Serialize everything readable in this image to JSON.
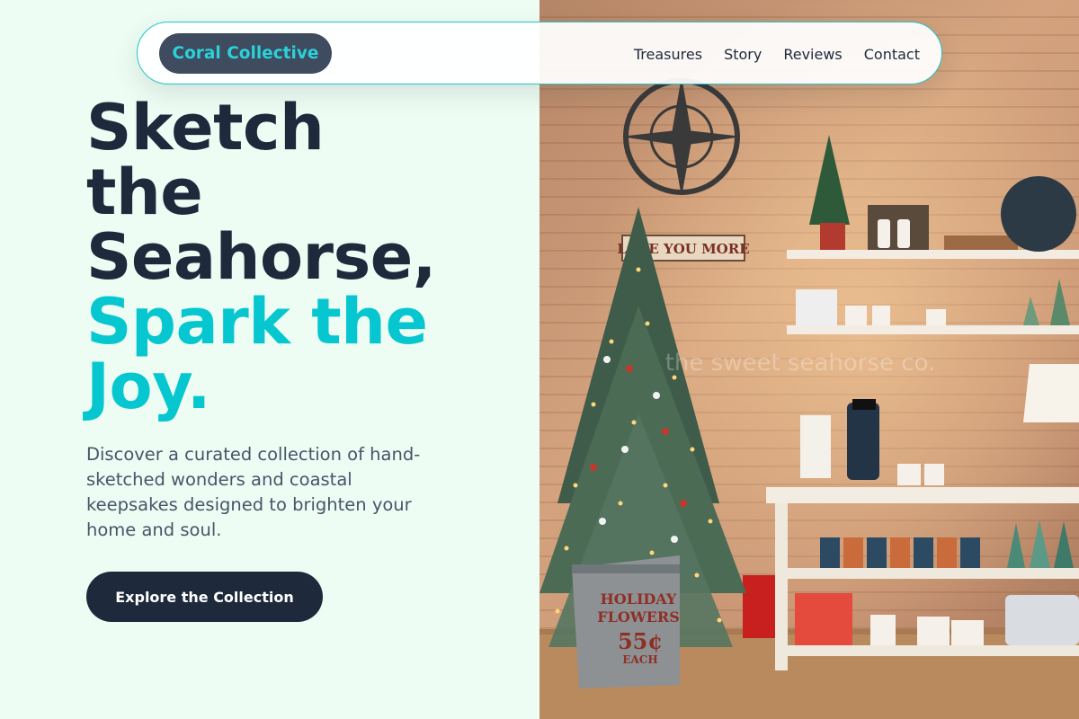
{
  "nav": {
    "brand": "Coral Collective",
    "links": [
      "Treasures",
      "Story",
      "Reviews",
      "Contact"
    ]
  },
  "hero": {
    "title_dark_1": "Sketch",
    "title_dark_2": "the",
    "title_dark_3": "Seahorse,",
    "title_accent_1": "Spark the",
    "title_accent_2": "Joy.",
    "description": "Discover a curated collection of hand-sketched wonders and coastal keepsakes designed to brighten your home and soul.",
    "cta_label": "Explore the Collection"
  },
  "photo": {
    "wall_sign": "LOVE YOU MORE",
    "bucket_text_1": "HOLIDAY",
    "bucket_text_2": "FLOWERS",
    "bucket_price": "55¢",
    "bucket_each": "EACH",
    "watermark": "the sweet seahorse co."
  },
  "colors": {
    "page_bg": "#edfdf3",
    "heading_dark": "#1e293b",
    "accent_cyan": "#06c7cf",
    "body_text": "#475569",
    "button_bg": "#1e293b",
    "brand_bg": "#3f4b5f"
  }
}
